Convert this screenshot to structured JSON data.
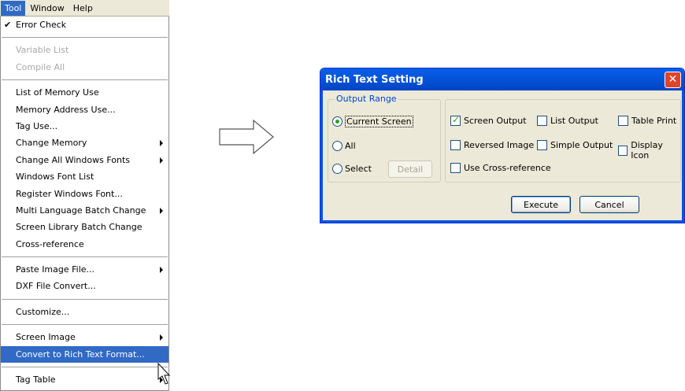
{
  "menubar": {
    "items": [
      "Tool",
      "Window",
      "Help"
    ]
  },
  "menu": {
    "items": [
      {
        "label": "Error Check",
        "checked": true
      },
      {
        "sep": true
      },
      {
        "label": "Variable List",
        "disabled": true
      },
      {
        "label": "Compile All",
        "disabled": true
      },
      {
        "sep": true
      },
      {
        "label": "List of Memory Use"
      },
      {
        "label": "Memory Address Use..."
      },
      {
        "label": "Tag Use..."
      },
      {
        "label": "Change Memory",
        "submenu": true
      },
      {
        "label": "Change All Windows Fonts",
        "submenu": true
      },
      {
        "label": "Windows Font List"
      },
      {
        "label": "Register Windows Font..."
      },
      {
        "label": "Multi Language Batch Change",
        "submenu": true
      },
      {
        "label": "Screen Library Batch Change"
      },
      {
        "label": "Cross-reference"
      },
      {
        "sep": true
      },
      {
        "label": "Paste Image File...",
        "submenu": true
      },
      {
        "label": "DXF File Convert..."
      },
      {
        "sep": true
      },
      {
        "label": "Customize..."
      },
      {
        "sep": true
      },
      {
        "label": "Screen Image",
        "submenu": true
      },
      {
        "label": "Convert to Rich Text Format...",
        "highlight": true
      },
      {
        "sep": true
      },
      {
        "label": "Tag Table",
        "submenu": true
      }
    ]
  },
  "dialog": {
    "title": "Rich Text Setting",
    "close_label": "✕",
    "output_range": {
      "legend": "Output Range",
      "current_screen": "Current Screen",
      "all": "All",
      "select": "Select",
      "detail": "Detail"
    },
    "options": {
      "screen_output": "Screen Output",
      "list_output": "List Output",
      "table_print": "Table Print",
      "reversed_image": "Reversed Image",
      "simple_output": "Simple Output",
      "display_icon": "Display Icon",
      "use_cross_reference": "Use Cross-reference"
    },
    "execute": "Execute",
    "cancel": "Cancel"
  }
}
